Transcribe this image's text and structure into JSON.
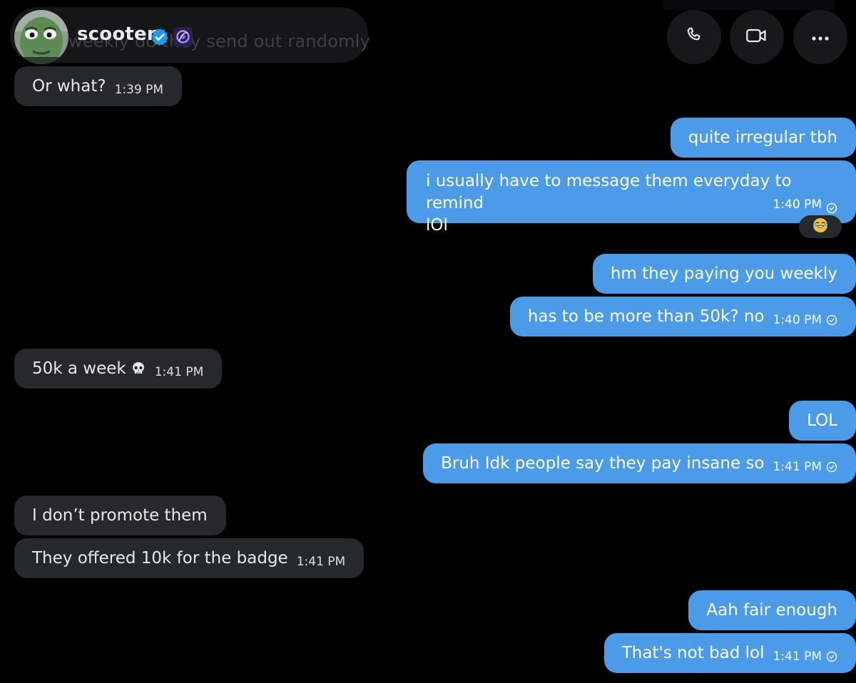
{
  "header": {
    "contact_name": "scooter",
    "preview_text": "weekly do they send out randomly",
    "icons": {
      "verified": "verified-badge-icon",
      "affiliate": "affiliate-badge-icon",
      "call": "phone-icon",
      "video": "video-camera-icon",
      "more": "more-dots-icon"
    }
  },
  "colors": {
    "background": "#000000",
    "incoming_bubble": "#26292b",
    "outgoing_bubble": "#4c9be9",
    "verified_blue": "#1d9bf0"
  },
  "messages": [
    {
      "from": "them",
      "text": "Or what?",
      "time": "1:39 PM"
    },
    {
      "from": "me",
      "text": "quite irregular tbh",
      "time": ""
    },
    {
      "from": "me",
      "line1": "i usually have to message them everyday to remind",
      "line2": "lOl",
      "time": "1:40 PM",
      "reaction": "😂"
    },
    {
      "from": "me",
      "text": "hm they paying you weekly",
      "time": ""
    },
    {
      "from": "me",
      "text": "has to be more than 50k? no",
      "time": "1:40 PM"
    },
    {
      "from": "them",
      "text": "50k a week",
      "emoji": "💀",
      "time": "1:41 PM"
    },
    {
      "from": "me",
      "text": "LOL",
      "time": ""
    },
    {
      "from": "me",
      "text": "Bruh Idk people say they pay insane so",
      "time": "1:41 PM"
    },
    {
      "from": "them",
      "text": "I don’t promote them",
      "time": ""
    },
    {
      "from": "them",
      "text": "They offered 10k for the badge",
      "time": "1:41 PM"
    },
    {
      "from": "me",
      "text": "Aah fair enough",
      "time": ""
    },
    {
      "from": "me",
      "text": "That's not bad lol",
      "time": "1:41 PM"
    }
  ]
}
